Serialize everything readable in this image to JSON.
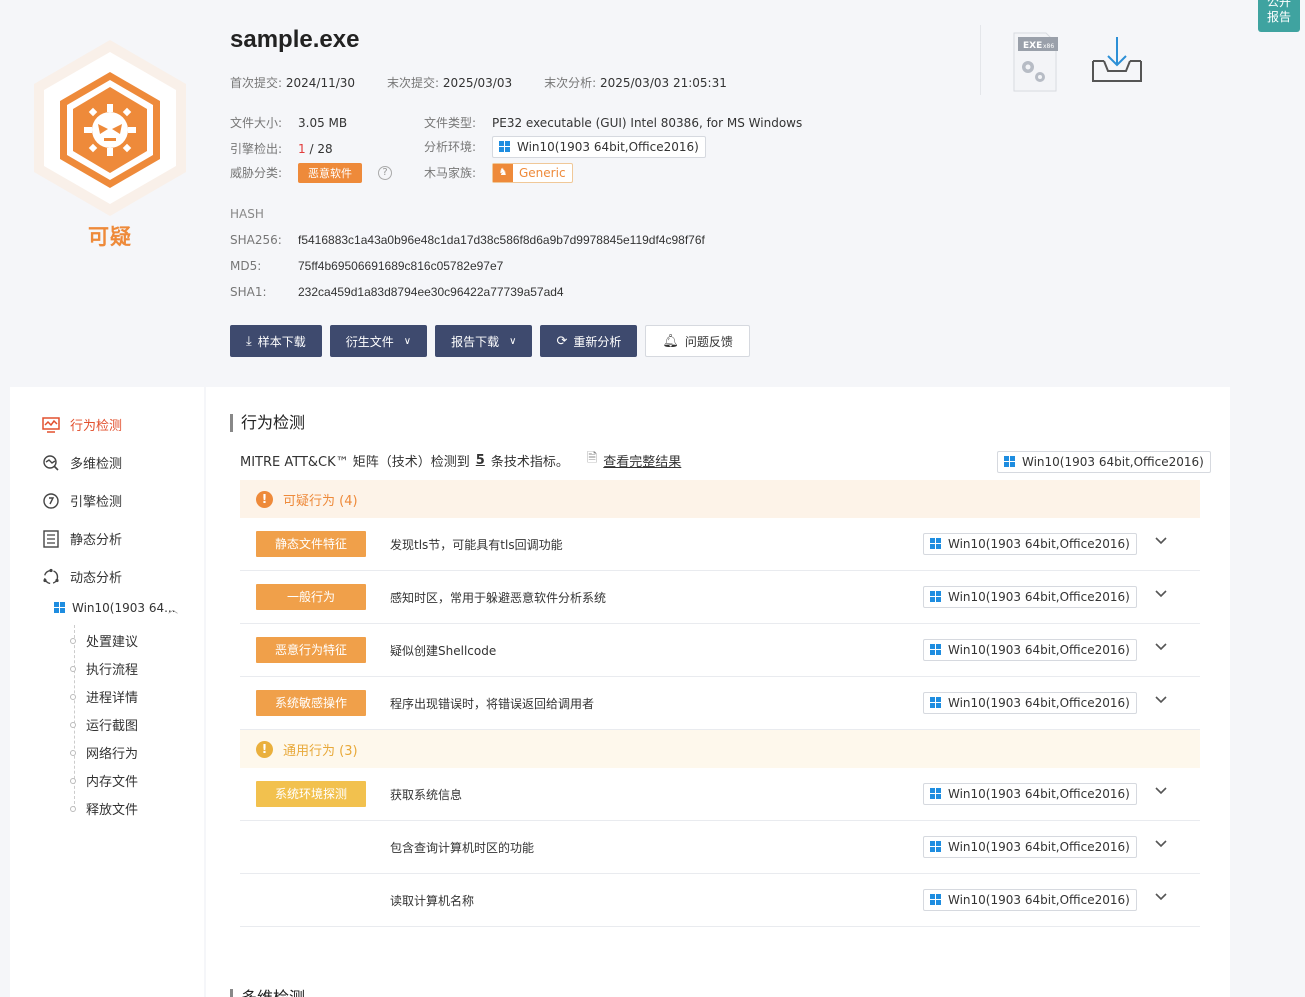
{
  "corner": {
    "line1": "公开",
    "line2": "报告"
  },
  "verdict": {
    "label": "可疑",
    "color": "#ee8a3a"
  },
  "file": {
    "name": "sample.exe",
    "first_submit_label": "首次提交:",
    "first_submit": "2024/11/30",
    "last_submit_label": "末次提交:",
    "last_submit": "2025/03/03",
    "last_analysis_label": "末次分析:",
    "last_analysis": "2025/03/03 21:05:31",
    "size_label": "文件大小:",
    "size": "3.05 MB",
    "type_label": "文件类型:",
    "type": "PE32 executable (GUI) Intel 80386, for MS Windows",
    "engine_label": "引擎检出:",
    "engine_hits": "1",
    "engine_total": " / 28",
    "env_label": "分析环境:",
    "env": "Win10(1903 64bit,Office2016)",
    "threat_label": "威胁分类:",
    "threat": "恶意软件",
    "help": "?",
    "family_label": "木马家族:",
    "family": "Generic"
  },
  "hash": {
    "title": "HASH",
    "sha256_label": "SHA256:",
    "sha256": "f5416883c1a43a0b96e48c1da17d38c586f8d6a9b7d9978845e119df4c98f76f",
    "md5_label": "MD5:",
    "md5": "75ff4b69506691689c816c05782e97e7",
    "sha1_label": "SHA1:",
    "sha1": "232ca459d1a83d8794ee30c96422a77739a57ad4"
  },
  "actions": {
    "download": "样本下载",
    "derived": "衍生文件",
    "report": "报告下载",
    "reanalyze": "重新分析",
    "feedback": "问题反馈"
  },
  "nav": {
    "items": [
      "行为检测",
      "多维检测",
      "引擎检测",
      "静态分析",
      "动态分析"
    ],
    "env": "Win10(1903 64...",
    "sub": [
      "处置建议",
      "执行流程",
      "进程详情",
      "运行截图",
      "网络行为",
      "内存文件",
      "释放文件"
    ]
  },
  "main": {
    "title": "行为检测",
    "mitre_prefix": "MITRE ATT&CK™ 矩阵（技术）检测到",
    "mitre_count": "5",
    "mitre_suffix": "条技术指标。",
    "mitre_link": "查看完整结果",
    "env": "Win10(1903 64bit,Office2016)",
    "groups": [
      {
        "title": "可疑行为 (4)"
      },
      {
        "title": "通用行为 (3)"
      }
    ],
    "rows": [
      {
        "cat": "静态文件特征",
        "desc": "发现tls节，可能具有tls回调功能",
        "env": "Win10(1903 64bit,Office2016)"
      },
      {
        "cat": "一般行为",
        "desc": "感知时区，常用于躲避恶意软件分析系统",
        "env": "Win10(1903 64bit,Office2016)"
      },
      {
        "cat": "恶意行为特征",
        "desc": "疑似创建Shellcode",
        "env": "Win10(1903 64bit,Office2016)"
      },
      {
        "cat": "系统敏感操作",
        "desc": "程序出现错误时，将错误返回给调用者",
        "env": "Win10(1903 64bit,Office2016)"
      },
      {
        "cat": "系统环境探测",
        "desc": "获取系统信息",
        "env": "Win10(1903 64bit,Office2016)"
      },
      {
        "cat": "",
        "desc": "包含查询计算机时区的功能",
        "env": "Win10(1903 64bit,Office2016)"
      },
      {
        "cat": "",
        "desc": "读取计算机名称",
        "env": "Win10(1903 64bit,Office2016)"
      }
    ],
    "next_title": "多维检测"
  },
  "top_icons": {
    "exe_label": "EXE",
    "exe_sub": "x86"
  }
}
